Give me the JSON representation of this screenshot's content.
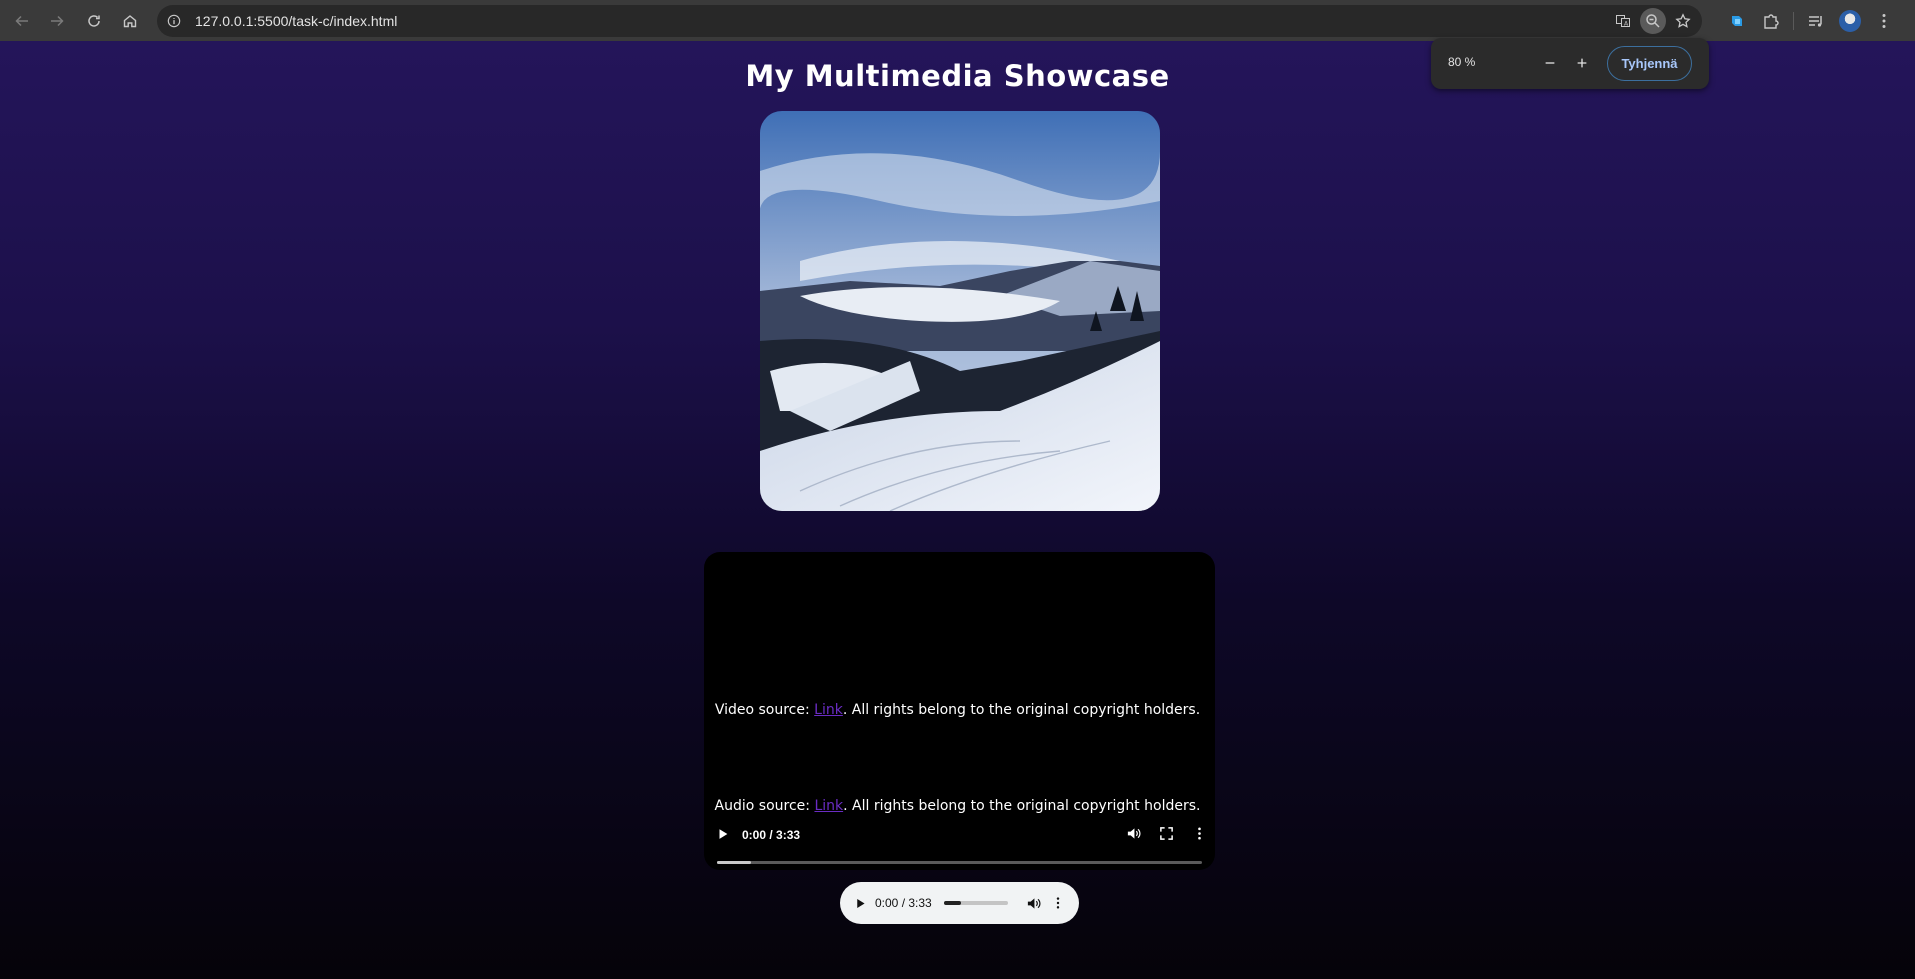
{
  "browser": {
    "url": "127.0.0.1:5500/task-c/index.html",
    "zoom_level": "80 %",
    "zoom_reset_label": "Tyhjennä"
  },
  "page": {
    "title": "My Multimedia Showcase",
    "video": {
      "time": "0:00 / 3:33",
      "buffered_fraction": 0.07
    },
    "video_caption": {
      "prefix": "Video source: ",
      "link": "Link",
      "suffix": ". All rights belong to the original copyright holders."
    },
    "audio": {
      "time": "0:00 / 3:33",
      "volume_fraction": 0.27
    },
    "audio_caption": {
      "prefix": "Audio source: ",
      "link": "Link",
      "suffix": ". All rights belong to the original copyright holders."
    }
  },
  "colors": {
    "background_top": "#24155a",
    "background_bottom": "#050309",
    "link": "#6a2cc4",
    "zoom_reset_text": "#a8c7fa"
  }
}
